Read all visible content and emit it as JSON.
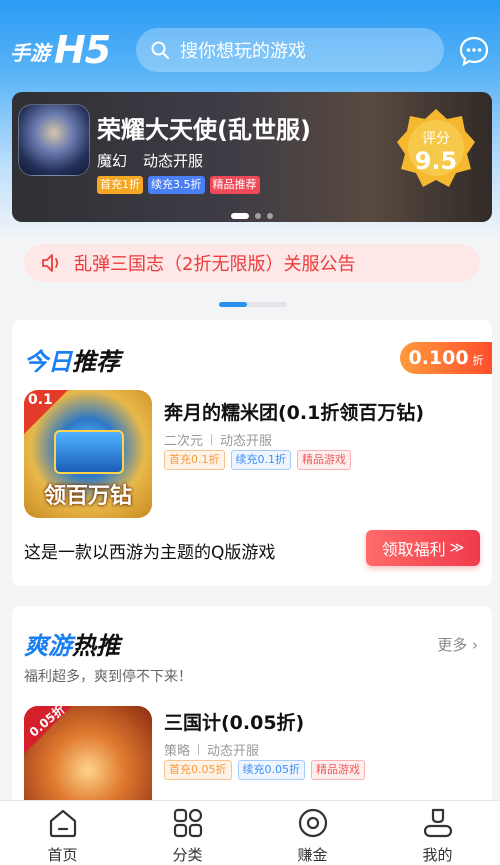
{
  "header": {
    "logo_cn": "手游",
    "logo_h5": "H5",
    "search_placeholder": "搜你想玩的游戏"
  },
  "banner": {
    "title": "荣耀大天使(乱世服)",
    "genre": "魔幻",
    "server": "动态开服",
    "tags": [
      "首充1折",
      "续充3.5折",
      "精品推荐"
    ],
    "rating_label": "评分",
    "rating_value": "9.5"
  },
  "notice": {
    "text": "乱弹三国志（2折无限版）关服公告"
  },
  "today": {
    "title_a": "今日",
    "title_b": "推荐",
    "discount_value": "0.100",
    "discount_unit": "折",
    "game": {
      "title": "奔月的糯米团(0.1折领百万钻)",
      "genre": "二次元",
      "server": "动态开服",
      "tags": [
        "首充0.1折",
        "续充0.1折",
        "精品游戏"
      ],
      "icon_corner": "0.1",
      "icon_word": "领百万钻"
    },
    "description": "这是一款以西游为主题的Q版游戏",
    "claim_label": "领取福利",
    "claim_arrow": "≫"
  },
  "hot": {
    "title_a": "爽游",
    "title_b": "热推",
    "more_label": "更多 ›",
    "subtitle": "福利超多，爽到停不下来！",
    "game": {
      "title": "三国计(0.05折)",
      "genre": "策略",
      "server": "动态开服",
      "tags": [
        "首充0.05折",
        "续充0.05折",
        "精品游戏"
      ],
      "icon_corner": "0.05折"
    }
  },
  "tabbar": {
    "items": [
      {
        "label": "首页",
        "icon": "home-icon"
      },
      {
        "label": "分类",
        "icon": "category-icon"
      },
      {
        "label": "赚金",
        "icon": "coin-icon"
      },
      {
        "label": "我的",
        "icon": "profile-icon"
      }
    ]
  },
  "colors": {
    "primary": "#2b8ff0",
    "accent_red": "#f03a4a",
    "discount_orange": "#ff7a33"
  }
}
